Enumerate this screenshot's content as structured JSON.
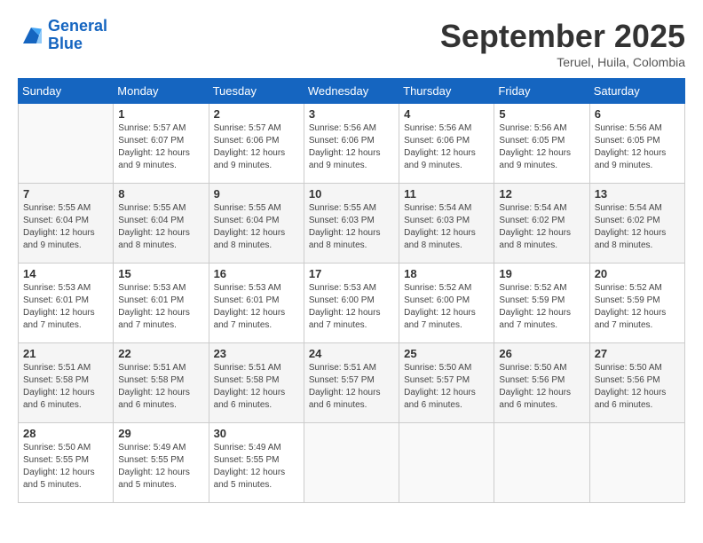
{
  "header": {
    "logo_line1": "General",
    "logo_line2": "Blue",
    "month": "September 2025",
    "location": "Teruel, Huila, Colombia"
  },
  "days_of_week": [
    "Sunday",
    "Monday",
    "Tuesday",
    "Wednesday",
    "Thursday",
    "Friday",
    "Saturday"
  ],
  "weeks": [
    [
      {
        "day": "",
        "info": ""
      },
      {
        "day": "1",
        "info": "Sunrise: 5:57 AM\nSunset: 6:07 PM\nDaylight: 12 hours\nand 9 minutes."
      },
      {
        "day": "2",
        "info": "Sunrise: 5:57 AM\nSunset: 6:06 PM\nDaylight: 12 hours\nand 9 minutes."
      },
      {
        "day": "3",
        "info": "Sunrise: 5:56 AM\nSunset: 6:06 PM\nDaylight: 12 hours\nand 9 minutes."
      },
      {
        "day": "4",
        "info": "Sunrise: 5:56 AM\nSunset: 6:06 PM\nDaylight: 12 hours\nand 9 minutes."
      },
      {
        "day": "5",
        "info": "Sunrise: 5:56 AM\nSunset: 6:05 PM\nDaylight: 12 hours\nand 9 minutes."
      },
      {
        "day": "6",
        "info": "Sunrise: 5:56 AM\nSunset: 6:05 PM\nDaylight: 12 hours\nand 9 minutes."
      }
    ],
    [
      {
        "day": "7",
        "info": "Sunrise: 5:55 AM\nSunset: 6:04 PM\nDaylight: 12 hours\nand 9 minutes."
      },
      {
        "day": "8",
        "info": "Sunrise: 5:55 AM\nSunset: 6:04 PM\nDaylight: 12 hours\nand 8 minutes."
      },
      {
        "day": "9",
        "info": "Sunrise: 5:55 AM\nSunset: 6:04 PM\nDaylight: 12 hours\nand 8 minutes."
      },
      {
        "day": "10",
        "info": "Sunrise: 5:55 AM\nSunset: 6:03 PM\nDaylight: 12 hours\nand 8 minutes."
      },
      {
        "day": "11",
        "info": "Sunrise: 5:54 AM\nSunset: 6:03 PM\nDaylight: 12 hours\nand 8 minutes."
      },
      {
        "day": "12",
        "info": "Sunrise: 5:54 AM\nSunset: 6:02 PM\nDaylight: 12 hours\nand 8 minutes."
      },
      {
        "day": "13",
        "info": "Sunrise: 5:54 AM\nSunset: 6:02 PM\nDaylight: 12 hours\nand 8 minutes."
      }
    ],
    [
      {
        "day": "14",
        "info": "Sunrise: 5:53 AM\nSunset: 6:01 PM\nDaylight: 12 hours\nand 7 minutes."
      },
      {
        "day": "15",
        "info": "Sunrise: 5:53 AM\nSunset: 6:01 PM\nDaylight: 12 hours\nand 7 minutes."
      },
      {
        "day": "16",
        "info": "Sunrise: 5:53 AM\nSunset: 6:01 PM\nDaylight: 12 hours\nand 7 minutes."
      },
      {
        "day": "17",
        "info": "Sunrise: 5:53 AM\nSunset: 6:00 PM\nDaylight: 12 hours\nand 7 minutes."
      },
      {
        "day": "18",
        "info": "Sunrise: 5:52 AM\nSunset: 6:00 PM\nDaylight: 12 hours\nand 7 minutes."
      },
      {
        "day": "19",
        "info": "Sunrise: 5:52 AM\nSunset: 5:59 PM\nDaylight: 12 hours\nand 7 minutes."
      },
      {
        "day": "20",
        "info": "Sunrise: 5:52 AM\nSunset: 5:59 PM\nDaylight: 12 hours\nand 7 minutes."
      }
    ],
    [
      {
        "day": "21",
        "info": "Sunrise: 5:51 AM\nSunset: 5:58 PM\nDaylight: 12 hours\nand 6 minutes."
      },
      {
        "day": "22",
        "info": "Sunrise: 5:51 AM\nSunset: 5:58 PM\nDaylight: 12 hours\nand 6 minutes."
      },
      {
        "day": "23",
        "info": "Sunrise: 5:51 AM\nSunset: 5:58 PM\nDaylight: 12 hours\nand 6 minutes."
      },
      {
        "day": "24",
        "info": "Sunrise: 5:51 AM\nSunset: 5:57 PM\nDaylight: 12 hours\nand 6 minutes."
      },
      {
        "day": "25",
        "info": "Sunrise: 5:50 AM\nSunset: 5:57 PM\nDaylight: 12 hours\nand 6 minutes."
      },
      {
        "day": "26",
        "info": "Sunrise: 5:50 AM\nSunset: 5:56 PM\nDaylight: 12 hours\nand 6 minutes."
      },
      {
        "day": "27",
        "info": "Sunrise: 5:50 AM\nSunset: 5:56 PM\nDaylight: 12 hours\nand 6 minutes."
      }
    ],
    [
      {
        "day": "28",
        "info": "Sunrise: 5:50 AM\nSunset: 5:55 PM\nDaylight: 12 hours\nand 5 minutes."
      },
      {
        "day": "29",
        "info": "Sunrise: 5:49 AM\nSunset: 5:55 PM\nDaylight: 12 hours\nand 5 minutes."
      },
      {
        "day": "30",
        "info": "Sunrise: 5:49 AM\nSunset: 5:55 PM\nDaylight: 12 hours\nand 5 minutes."
      },
      {
        "day": "",
        "info": ""
      },
      {
        "day": "",
        "info": ""
      },
      {
        "day": "",
        "info": ""
      },
      {
        "day": "",
        "info": ""
      }
    ]
  ]
}
